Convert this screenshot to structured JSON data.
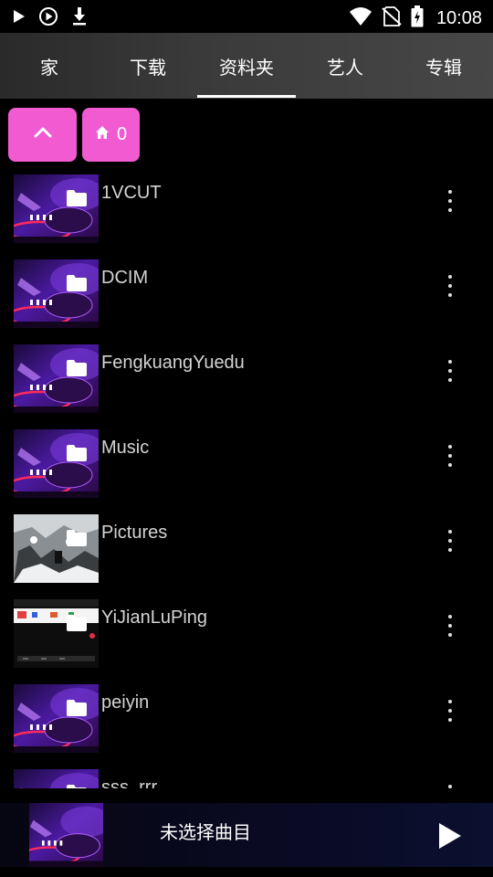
{
  "status_bar": {
    "time": "10:08",
    "left_icons": [
      "play-icon",
      "circle-play-icon",
      "download-icon"
    ],
    "right_icons": [
      "wifi-icon",
      "no-sim-icon",
      "battery-icon"
    ]
  },
  "tabs": [
    {
      "label": "家",
      "selected": false
    },
    {
      "label": "下载",
      "selected": false
    },
    {
      "label": "资料夹",
      "selected": true
    },
    {
      "label": "艺人",
      "selected": false
    },
    {
      "label": "专辑",
      "selected": false
    }
  ],
  "breadcrumb": {
    "up_icon": "chevron-up-icon",
    "home_icon": "home-icon",
    "home_count": "0",
    "accent": "#f25ad2"
  },
  "folders": [
    {
      "name": "1VCUT",
      "thumb": "dj"
    },
    {
      "name": "DCIM",
      "thumb": "dj"
    },
    {
      "name": "FengkuangYuedu",
      "thumb": "dj"
    },
    {
      "name": "Music",
      "thumb": "dj"
    },
    {
      "name": "Pictures",
      "thumb": "photo"
    },
    {
      "name": "YiJianLuPing",
      "thumb": "screenshot"
    },
    {
      "name": "peiyin",
      "thumb": "dj"
    },
    {
      "name": "sss_rrr",
      "thumb": "dj"
    }
  ],
  "player": {
    "title": "未选择曲目",
    "play_icon": "play-icon"
  }
}
